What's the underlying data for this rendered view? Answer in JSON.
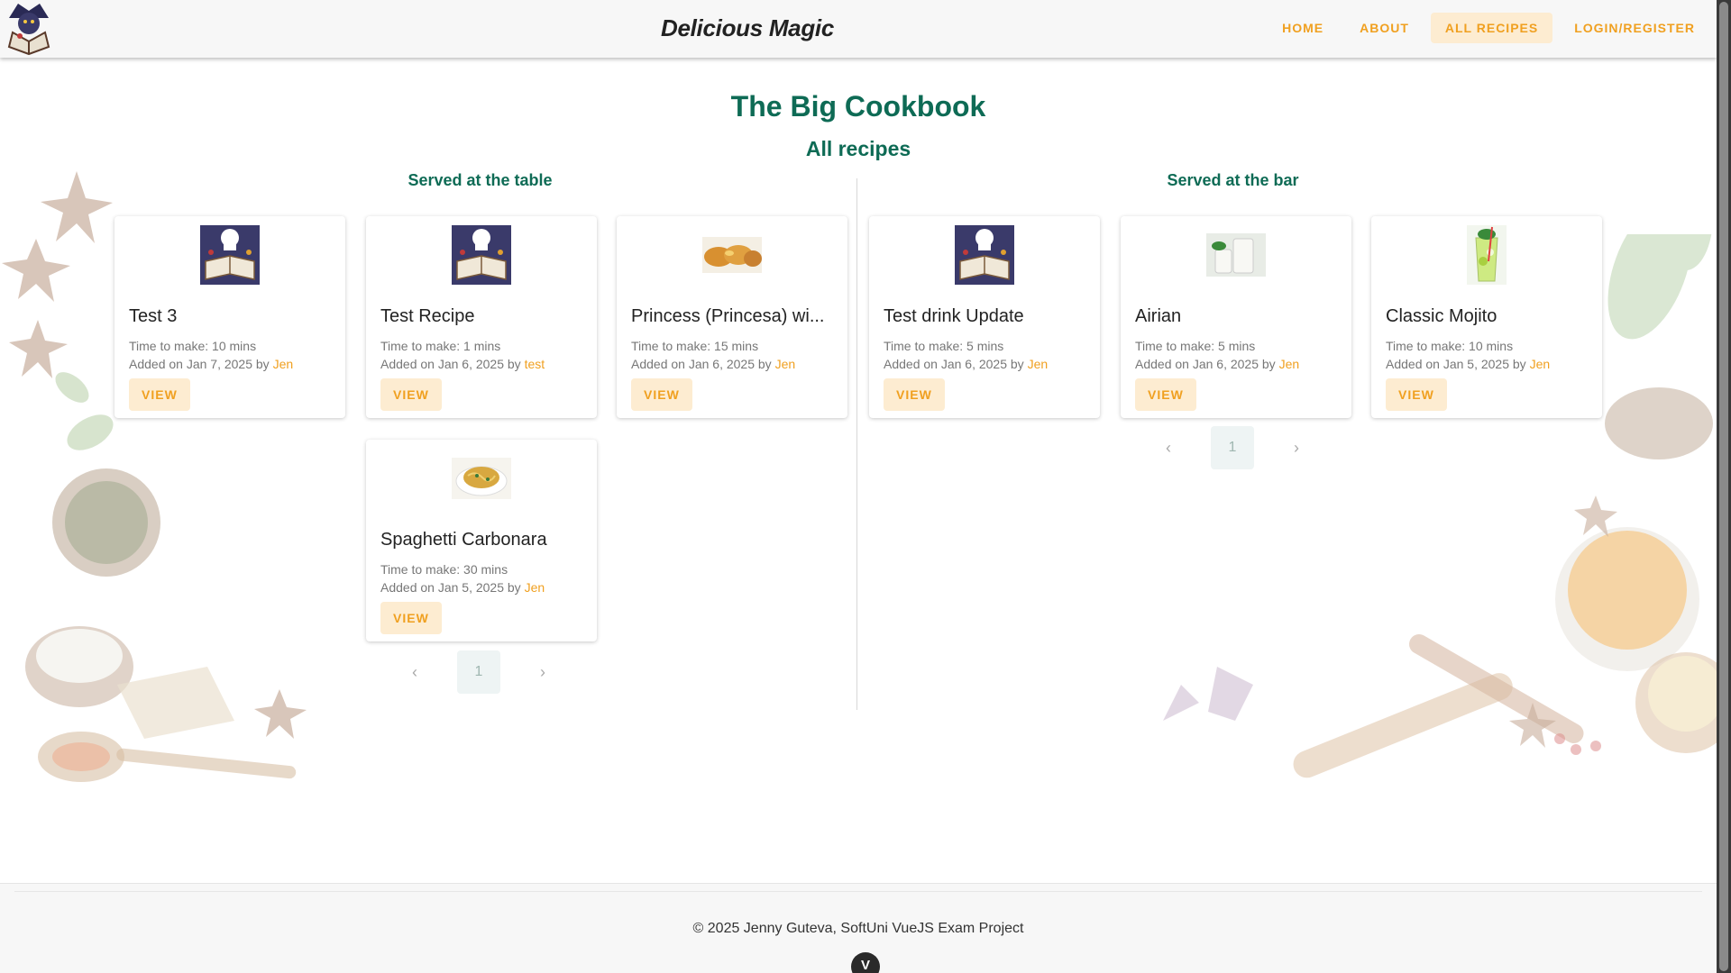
{
  "header": {
    "brand": "Delicious Magic",
    "nav": [
      {
        "label": "Home"
      },
      {
        "label": "About"
      },
      {
        "label": "All Recipes"
      },
      {
        "label": "Login/Register"
      }
    ]
  },
  "page": {
    "title": "The Big Cookbook",
    "subtitle": "All recipes"
  },
  "table_section": {
    "title": "Served at the table",
    "cards": [
      {
        "title": "Test 3",
        "time": "Time to make: 10 mins",
        "added": "Added on Jan 7, 2025 by",
        "author": "Jen",
        "view": "VIEW",
        "thumb": "book-icon"
      },
      {
        "title": "Test Recipe",
        "time": "Time to make: 1 mins",
        "added": "Added on Jan 6, 2025 by",
        "author": "test",
        "view": "VIEW",
        "thumb": "book-icon"
      },
      {
        "title": "Princess (Princesa) wi...",
        "time": "Time to make: 15 mins",
        "added": "Added on Jan 6, 2025 by",
        "author": "Jen",
        "view": "VIEW",
        "thumb": "toast-icon"
      },
      {
        "title": "Spaghetti Carbonara",
        "time": "Time to make: 30 mins",
        "added": "Added on Jan 5, 2025 by",
        "author": "Jen",
        "view": "VIEW",
        "thumb": "pasta-icon"
      }
    ],
    "page_number": "1"
  },
  "bar_section": {
    "title": "Served at the bar",
    "cards": [
      {
        "title": "Test drink Update",
        "time": "Time to make: 5 mins",
        "added": "Added on Jan 6, 2025 by",
        "author": "Jen",
        "view": "VIEW",
        "thumb": "book-icon"
      },
      {
        "title": "Airian",
        "time": "Time to make: 5 mins",
        "added": "Added on Jan 6, 2025 by",
        "author": "Jen",
        "view": "VIEW",
        "thumb": "yogurt-drink-icon"
      },
      {
        "title": "Classic Mojito",
        "time": "Time to make: 10 mins",
        "added": "Added on Jan 5, 2025 by",
        "author": "Jen",
        "view": "VIEW",
        "thumb": "mojito-icon"
      }
    ],
    "page_number": "1"
  },
  "footer": {
    "text": "© 2025 Jenny Guteva, SoftUni VueJS Exam Project",
    "badge": "V"
  },
  "colors": {
    "accent": "#f0a020",
    "heading": "#0e6b55",
    "button_bg": "#fdecd1"
  }
}
